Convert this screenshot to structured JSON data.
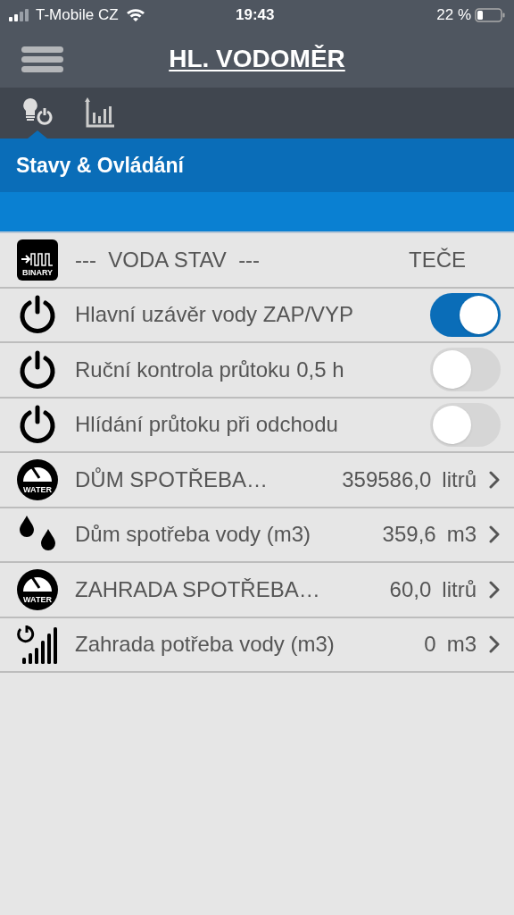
{
  "status_bar": {
    "carrier": "T-Mobile CZ",
    "time": "19:43",
    "battery": "22 %"
  },
  "header": {
    "title": "HL. VODOMĚR"
  },
  "tabs": [
    {
      "selected": true
    },
    {
      "selected": false
    }
  ],
  "section": {
    "title": "Stavy & Ovládání"
  },
  "rows": [
    {
      "kind": "status",
      "icon": {
        "kind": "binary",
        "text": "BINARY"
      },
      "label": "---  VODA STAV  ---",
      "value": "TEČE"
    },
    {
      "kind": "switch",
      "icon": {
        "kind": "power"
      },
      "label": "Hlavní uzávěr vody ZAP/VYP",
      "on": true
    },
    {
      "kind": "switch",
      "icon": {
        "kind": "power"
      },
      "label": "Ruční kontrola průtoku 0,5 h",
      "on": false
    },
    {
      "kind": "switch",
      "icon": {
        "kind": "power"
      },
      "label": "Hlídání průtoku při odchodu",
      "on": false
    },
    {
      "kind": "value",
      "icon": {
        "kind": "meter",
        "text": "WATER"
      },
      "label": "DŮM SPOTŘEBA…",
      "value": "359586,0",
      "unit": "litrů"
    },
    {
      "kind": "value",
      "icon": {
        "kind": "drops"
      },
      "label": "Dům spotřeba vody (m3)",
      "value": "359,6",
      "unit": "m3"
    },
    {
      "kind": "value",
      "icon": {
        "kind": "meter",
        "text": "WATER"
      },
      "label": "ZAHRADA SPOTŘEBA…",
      "value": "60,0",
      "unit": "litrů"
    },
    {
      "kind": "value",
      "icon": {
        "kind": "signal"
      },
      "label": "Zahrada potřeba vody (m3)",
      "value": "0",
      "unit": "m3"
    }
  ]
}
